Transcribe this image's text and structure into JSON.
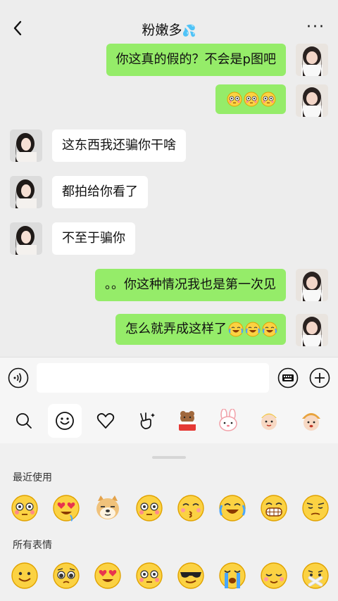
{
  "header": {
    "title": "粉嫩多",
    "title_emoji": "💦",
    "more": "···",
    "back_icon": "chevron-left-icon"
  },
  "messages": [
    {
      "side": "out",
      "text": "你这真的假的？不会是p图吧",
      "emojis": []
    },
    {
      "side": "out",
      "text": "",
      "emojis": [
        "flushed",
        "flushed",
        "flushed"
      ]
    },
    {
      "side": "in",
      "text": "这东西我还骗你干啥",
      "emojis": []
    },
    {
      "side": "in",
      "text": "都拍给你看了",
      "emojis": []
    },
    {
      "side": "in",
      "text": "不至于骗你",
      "emojis": []
    },
    {
      "side": "out",
      "text": "。。你这种情况我也是第一次见",
      "emojis": []
    },
    {
      "side": "out",
      "text": "怎么就弄成这样了",
      "emojis": [
        "laugh-cry",
        "laugh-cry",
        "laugh-cry"
      ]
    }
  ],
  "input": {
    "placeholder": ""
  },
  "emoji_tabs": [
    "search-icon",
    "smiley-icon",
    "heart-icon",
    "victory-hand-icon",
    "bear-sticker-icon",
    "bunny-sticker-icon",
    "baby-sticker-icon",
    "baby-hat-sticker-icon"
  ],
  "panel": {
    "recent_label": "最近使用",
    "all_label": "所有表情",
    "recent": [
      "flushed",
      "heart-eyes",
      "doge",
      "flushed",
      "kissing",
      "laugh-cry",
      "grin",
      "smirk"
    ],
    "all": [
      "smile",
      "pleading",
      "heart-eyes",
      "flushed",
      "cool",
      "crying",
      "relieved",
      "mouth-crossed"
    ]
  },
  "colors": {
    "bubble_out": "#95ec69",
    "bubble_in": "#ffffff",
    "background": "#ededed"
  }
}
